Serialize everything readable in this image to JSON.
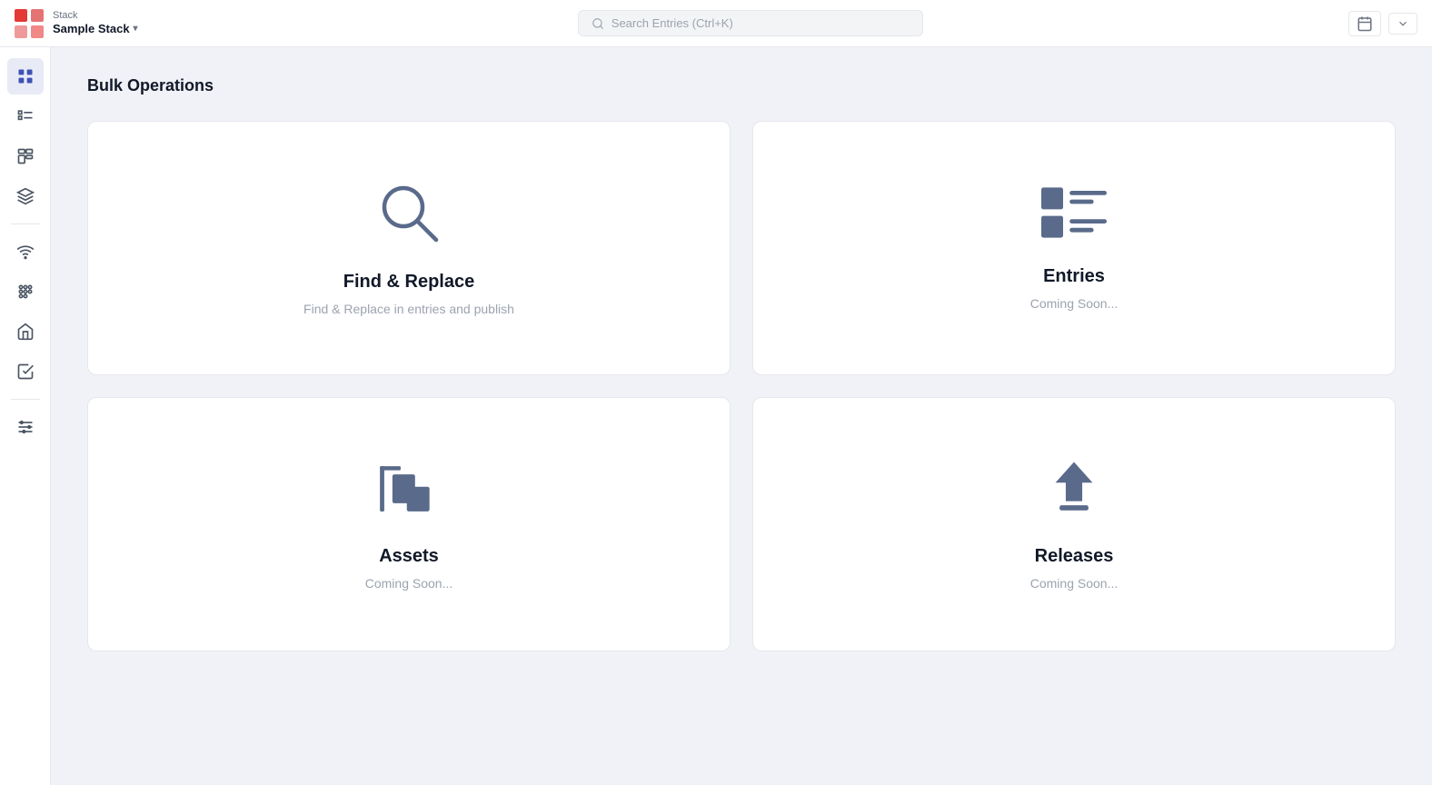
{
  "header": {
    "stack_label": "Stack",
    "stack_name": "Sample Stack",
    "search_placeholder": "Search Entries (Ctrl+K)"
  },
  "sidebar": {
    "items": [
      {
        "id": "dashboard",
        "icon": "grid",
        "active": true
      },
      {
        "id": "list",
        "icon": "list"
      },
      {
        "id": "widgets",
        "icon": "widgets"
      },
      {
        "id": "layers",
        "icon": "layers"
      },
      {
        "divider": true
      },
      {
        "id": "wifi",
        "icon": "wifi"
      },
      {
        "id": "apps",
        "icon": "apps"
      },
      {
        "id": "home",
        "icon": "home"
      },
      {
        "id": "tasks",
        "icon": "tasks"
      },
      {
        "divider": true
      },
      {
        "id": "settings",
        "icon": "settings"
      }
    ]
  },
  "page": {
    "title": "Bulk Operations",
    "cards": [
      {
        "id": "find-replace",
        "title": "Find & Replace",
        "subtitle": "Find & Replace in entries and publish",
        "icon": "search",
        "coming_soon": false
      },
      {
        "id": "entries",
        "title": "Entries",
        "subtitle": "Coming Soon...",
        "icon": "entries",
        "coming_soon": true
      },
      {
        "id": "assets",
        "title": "Assets",
        "subtitle": "Coming Soon...",
        "icon": "assets",
        "coming_soon": true
      },
      {
        "id": "releases",
        "title": "Releases",
        "subtitle": "Coming Soon...",
        "icon": "releases",
        "coming_soon": true
      }
    ]
  }
}
